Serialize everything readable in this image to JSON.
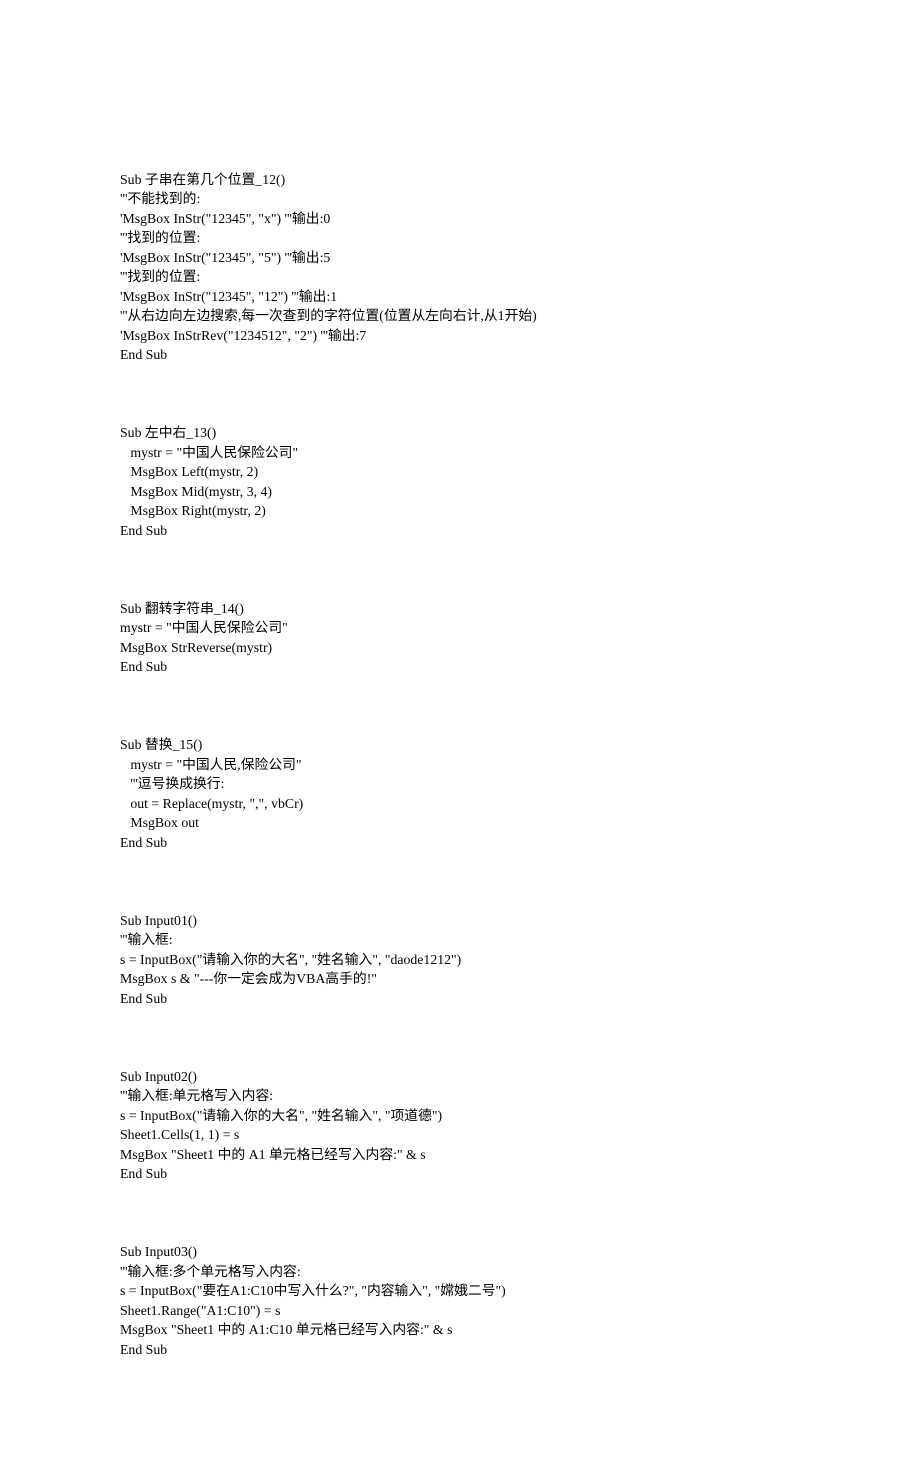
{
  "blocks": [
    [
      "Sub 子串在第几个位置_12()",
      "'''不能找到的:",
      "'MsgBox InStr(\"12345\", \"x\") '''输出:0",
      "'''找到的位置:",
      "'MsgBox InStr(\"12345\", \"5\") '''输出:5",
      "'''找到的位置:",
      "'MsgBox InStr(\"12345\", \"12\") '''输出:1",
      "'''从右边向左边搜索,每一次查到的字符位置(位置从左向右计,从1开始)",
      "'MsgBox InStrRev(\"1234512\", \"2\") '''输出:7",
      "End Sub"
    ],
    [
      "Sub 左中右_13()",
      "   mystr = \"中国人民保险公司\"",
      "   MsgBox Left(mystr, 2)",
      "   MsgBox Mid(mystr, 3, 4)",
      "   MsgBox Right(mystr, 2)",
      "End Sub"
    ],
    [
      "Sub 翻转字符串_14()",
      "mystr = \"中国人民保险公司\"",
      "MsgBox StrReverse(mystr)",
      "End Sub"
    ],
    [
      "Sub 替换_15()",
      "   mystr = \"中国人民,保险公司\"",
      "   '''逗号换成换行:",
      "   out = Replace(mystr, \",\", vbCr)",
      "   MsgBox out",
      "End Sub"
    ],
    [
      "Sub Input01()",
      "'''输入框:",
      "s = InputBox(\"请输入你的大名\", \"姓名输入\", \"daode1212\")",
      "MsgBox s & \"---你一定会成为VBA高手的!\"",
      "End Sub"
    ],
    [
      "Sub Input02()",
      "'''输入框:单元格写入内容:",
      "s = InputBox(\"请输入你的大名\", \"姓名输入\", \"项道德\")",
      "Sheet1.Cells(1, 1) = s",
      "MsgBox \"Sheet1 中的 A1 单元格已经写入内容:\" & s",
      "End Sub"
    ],
    [
      "Sub Input03()",
      "'''输入框:多个单元格写入内容:",
      "s = InputBox(\"要在A1:C10中写入什么?\", \"内容输入\", \"嫦娥二号\")",
      "Sheet1.Range(\"A1:C10\") = s",
      "MsgBox \"Sheet1 中的 A1:C10 单元格已经写入内容:\" & s",
      "End Sub"
    ]
  ]
}
